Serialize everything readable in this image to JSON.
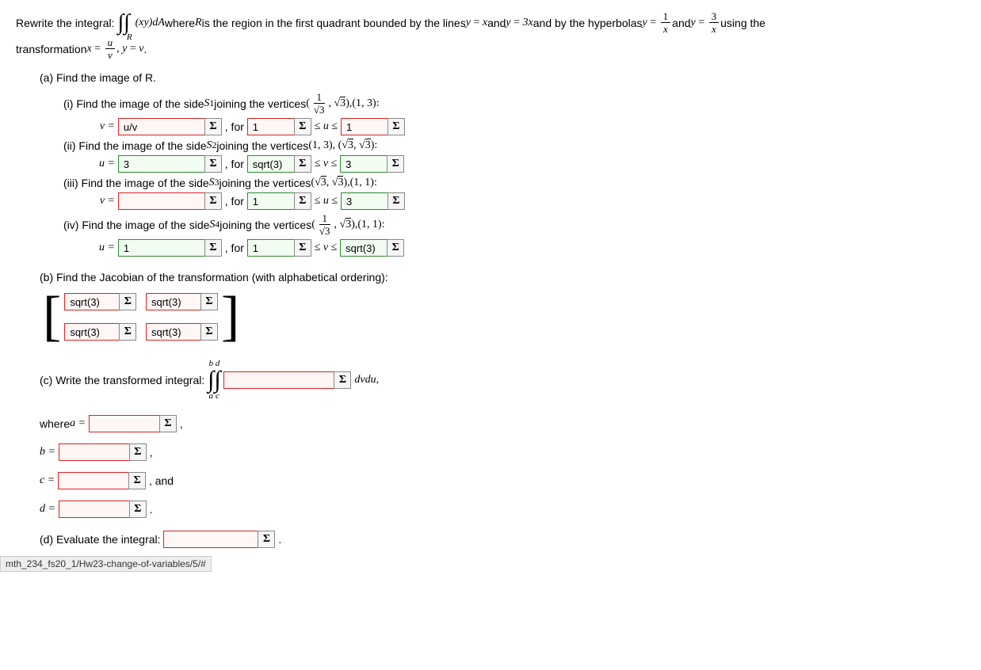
{
  "header": {
    "prefix": "Rewrite the integral:",
    "integral_region": "R",
    "integrand": "(xy)dA",
    "mid1": " where ",
    "R": "R",
    "mid2": " is the region in the first quadrant bounded by the lines ",
    "eq1_lhs": "y",
    "eq1_rhs": "x",
    "and1": " and ",
    "eq2_lhs": "y",
    "eq2_rhs": "3x",
    "mid3": " and by the hyperbolas ",
    "eq3_lhs": "y",
    "eq3_num": "1",
    "eq3_den": "x",
    "and2": " and ",
    "eq4_lhs": "y",
    "eq4_num": "3",
    "eq4_den": "x",
    "tail": " using the",
    "line2_prefix": "transformation ",
    "tx_lhs": "x",
    "tx_num": "u",
    "tx_den": "v",
    "ty_lhs": "y",
    "ty_rhs": "v",
    "period": "."
  },
  "a": {
    "title": "(a) Find the image of R.",
    "i": {
      "prompt": "(i) Find the image of the side ",
      "side": "S",
      "sub": "1",
      "mid": " joining the vertices ",
      "v1a": "1",
      "v1b": "3",
      "v2": "(1, 3)",
      "lhs": "v =",
      "in1": "u/v",
      "for": ", for",
      "in2": "1",
      "rel": "≤ u ≤",
      "in3": "1"
    },
    "ii": {
      "prompt": "(ii) Find the image of the side ",
      "side": "S",
      "sub": "2",
      "mid": " joining the vertices ",
      "v1": "(1, 3)",
      "v2a": "3",
      "v2b": "3",
      "lhs": "u =",
      "in1": "3",
      "for": ", for",
      "in2": "sqrt(3)",
      "rel": "≤ v ≤",
      "in3": "3"
    },
    "iii": {
      "prompt": "(iii) Find the image of the side ",
      "side": "S",
      "sub": "3",
      "mid": " joining the vertices ",
      "v1a": "3",
      "v1b": "3",
      "v2": "(1, 1)",
      "lhs": "v =",
      "in1": "",
      "for": ", for",
      "in2": "1",
      "rel": "≤ u ≤",
      "in3": "3"
    },
    "iv": {
      "prompt": "(iv) Find the image of the side ",
      "side": "S",
      "sub": "4",
      "mid": " joining the vertices ",
      "v1a": "1",
      "v1b": "3",
      "v2": "(1, 1)",
      "lhs": "u =",
      "in1": "1",
      "for": ", for",
      "in2": "1",
      "rel": "≤ v ≤",
      "in3": "sqrt(3)"
    }
  },
  "b": {
    "title": "(b) Find the Jacobian of the transformation (with alphabetical ordering):",
    "m11": "sqrt(3)",
    "m12": "sqrt(3)",
    "m21": "sqrt(3)",
    "m22": "sqrt(3)"
  },
  "c": {
    "title": "(c) Write the transformed integral:",
    "limits": {
      "a": "a",
      "b": "b",
      "c": "c",
      "d": "d"
    },
    "tail": "dvdu,",
    "where": "where ",
    "a_lbl": "a =",
    "b_lbl": "b =",
    "c_lbl": "c =",
    "d_lbl": "d =",
    "and": ", and",
    "comma": ",",
    "period": "."
  },
  "d": {
    "title": "(d) Evaluate the integral:",
    "period": "."
  },
  "sigma": "Σ",
  "footer": "mth_234_fs20_1/Hw23-change-of-variables/5/#"
}
